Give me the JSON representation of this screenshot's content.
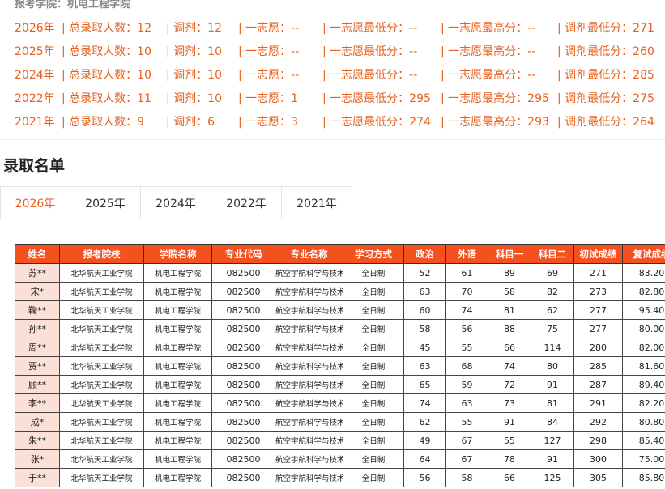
{
  "college_header": "报考学院：机电工程学院",
  "stats": [
    {
      "year": "2026年",
      "total": "总录取人数：12",
      "adjust": "调剂：12",
      "first": "一志愿：--",
      "first_min": "一志愿最低分：--",
      "first_max": "一志愿最高分：--",
      "adjust_min": "调剂最低分：271"
    },
    {
      "year": "2025年",
      "total": "总录取人数：10",
      "adjust": "调剂：10",
      "first": "一志愿：--",
      "first_min": "一志愿最低分：--",
      "first_max": "一志愿最高分：--",
      "adjust_min": "调剂最低分：260"
    },
    {
      "year": "2024年",
      "total": "总录取人数：10",
      "adjust": "调剂：10",
      "first": "一志愿：--",
      "first_min": "一志愿最低分：--",
      "first_max": "一志愿最高分：--",
      "adjust_min": "调剂最低分：285"
    },
    {
      "year": "2022年",
      "total": "总录取人数：11",
      "adjust": "调剂：10",
      "first": "一志愿：1",
      "first_min": "一志愿最低分：295",
      "first_max": "一志愿最高分：295",
      "adjust_min": "调剂最低分：275"
    },
    {
      "year": "2021年",
      "total": "总录取人数：9",
      "adjust": "调剂：6",
      "first": "一志愿：3",
      "first_min": "一志愿最低分：274",
      "first_max": "一志愿最高分：293",
      "adjust_min": "调剂最低分：264"
    }
  ],
  "section_title": "录取名单",
  "tabs": [
    "2026年",
    "2025年",
    "2024年",
    "2022年",
    "2021年"
  ],
  "active_tab": "2026年",
  "table": {
    "headers": [
      "姓名",
      "报考院校",
      "学院名称",
      "专业代码",
      "专业名称",
      "学习方式",
      "政治",
      "外语",
      "科目一",
      "科目二",
      "初试成绩",
      "复试成绩"
    ],
    "rows": [
      [
        "苏**",
        "北华航天工业学院",
        "机电工程学院",
        "082500",
        "航空宇航科学与技术",
        "全日制",
        "52",
        "61",
        "89",
        "69",
        "271",
        "83.20"
      ],
      [
        "宋*",
        "北华航天工业学院",
        "机电工程学院",
        "082500",
        "航空宇航科学与技术",
        "全日制",
        "63",
        "70",
        "58",
        "82",
        "273",
        "82.80"
      ],
      [
        "鞠**",
        "北华航天工业学院",
        "机电工程学院",
        "082500",
        "航空宇航科学与技术",
        "全日制",
        "60",
        "74",
        "81",
        "62",
        "277",
        "95.40"
      ],
      [
        "孙**",
        "北华航天工业学院",
        "机电工程学院",
        "082500",
        "航空宇航科学与技术",
        "全日制",
        "58",
        "56",
        "88",
        "75",
        "277",
        "80.00"
      ],
      [
        "周**",
        "北华航天工业学院",
        "机电工程学院",
        "082500",
        "航空宇航科学与技术",
        "全日制",
        "45",
        "55",
        "66",
        "114",
        "280",
        "82.00"
      ],
      [
        "贾**",
        "北华航天工业学院",
        "机电工程学院",
        "082500",
        "航空宇航科学与技术",
        "全日制",
        "63",
        "68",
        "74",
        "80",
        "285",
        "81.60"
      ],
      [
        "顾**",
        "北华航天工业学院",
        "机电工程学院",
        "082500",
        "航空宇航科学与技术",
        "全日制",
        "65",
        "59",
        "72",
        "91",
        "287",
        "89.40"
      ],
      [
        "李**",
        "北华航天工业学院",
        "机电工程学院",
        "082500",
        "航空宇航科学与技术",
        "全日制",
        "74",
        "63",
        "73",
        "81",
        "291",
        "82.20"
      ],
      [
        "成*",
        "北华航天工业学院",
        "机电工程学院",
        "082500",
        "航空宇航科学与技术",
        "全日制",
        "62",
        "55",
        "91",
        "84",
        "292",
        "80.80"
      ],
      [
        "朱**",
        "北华航天工业学院",
        "机电工程学院",
        "082500",
        "航空宇航科学与技术",
        "全日制",
        "49",
        "67",
        "55",
        "127",
        "298",
        "85.40"
      ],
      [
        "张*",
        "北华航天工业学院",
        "机电工程学院",
        "082500",
        "航空宇航科学与技术",
        "全日制",
        "64",
        "67",
        "78",
        "91",
        "300",
        "75.00"
      ],
      [
        "于**",
        "北华航天工业学院",
        "机电工程学院",
        "082500",
        "航空宇航科学与技术",
        "全日制",
        "56",
        "58",
        "66",
        "125",
        "305",
        "85.80"
      ]
    ]
  }
}
